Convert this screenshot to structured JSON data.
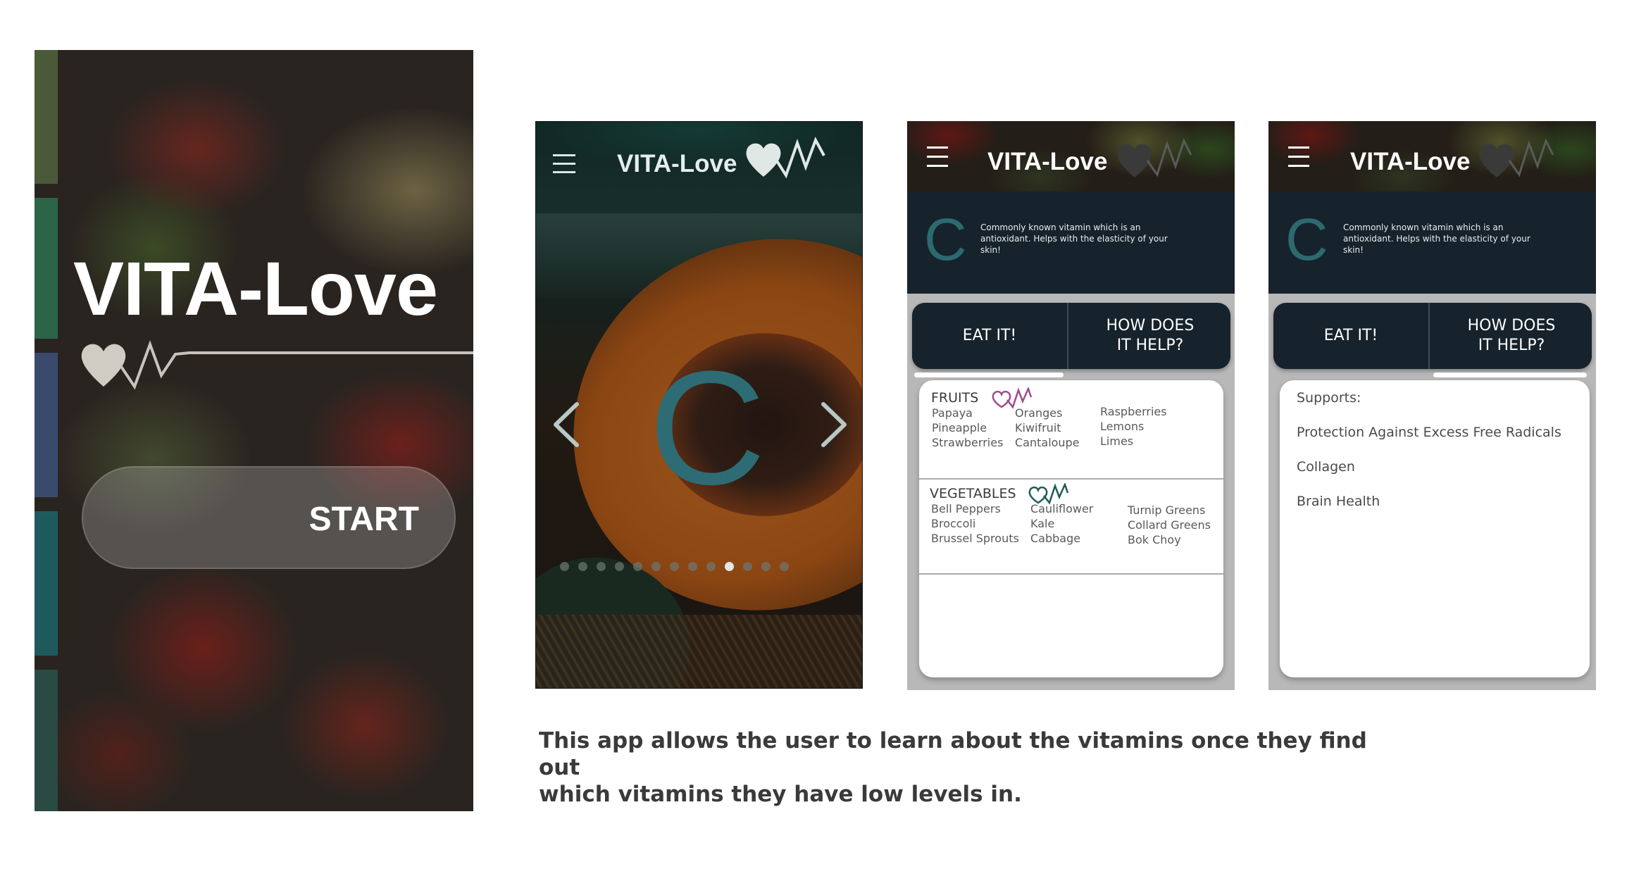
{
  "colors": {
    "dark_navy": "#16232c",
    "vitamin_teal": "#2c6a70",
    "fruit_accent": "#a04a8e",
    "veg_accent": "#1f5c58",
    "caption_text": "#3a3a3a"
  },
  "screen1": {
    "app_title": "VITA-Love",
    "start_label": "START",
    "strip_colors": [
      "#4a5a38",
      "#2c6448",
      "#3a4a6c",
      "#1e5a5c",
      "#2a4a44"
    ]
  },
  "screen2": {
    "app_title": "VITA-Love",
    "vitamin_letter": "C",
    "menu_icon": "hamburger-icon",
    "prev_icon": "chevron-left-icon",
    "next_icon": "chevron-right-icon",
    "carousel": {
      "total": 13,
      "active_index": 9
    }
  },
  "screen3": {
    "app_title": "VITA-Love",
    "vitamin_letter": "C",
    "vitamin_description": "Commonly known vitamin which is an antioxidant. Helps with the elasticity of your skin!",
    "tab_eat": "EAT IT!",
    "tab_how_line1": "HOW DOES",
    "tab_how_line2": "IT HELP?",
    "active_tab": "EAT IT!",
    "fruits_header": "FRUITS",
    "fruits_col1": [
      "Papaya",
      "Pineapple",
      "Strawberries"
    ],
    "fruits_col2": [
      "Oranges",
      "Kiwifruit",
      "Cantaloupe"
    ],
    "fruits_col3": [
      "Raspberries",
      "Lemons",
      "Limes"
    ],
    "vegetables_header": "VEGETABLES",
    "veg_col1": [
      "Bell Peppers",
      "Broccoli",
      "Brussel Sprouts"
    ],
    "veg_col2": [
      "Cauliflower",
      "Kale",
      "Cabbage"
    ],
    "veg_col3": [
      "Turnip Greens",
      "Collard Greens",
      "Bok Choy"
    ]
  },
  "screen4": {
    "app_title": "VITA-Love",
    "vitamin_letter": "C",
    "vitamin_description": "Commonly known vitamin which is an antioxidant. Helps with the elasticity of your skin!",
    "tab_eat": "EAT IT!",
    "tab_how_line1": "HOW DOES",
    "tab_how_line2": "IT HELP?",
    "active_tab": "HOW DOES IT HELP?",
    "supports_header": "Supports:",
    "supports": [
      "Protection Against Excess Free Radicals",
      "Collagen",
      "Brain Health"
    ]
  },
  "caption": {
    "line1": "This app allows the user to learn about the vitamins once they find out",
    "line2": "which vitamins they have low levels in."
  }
}
